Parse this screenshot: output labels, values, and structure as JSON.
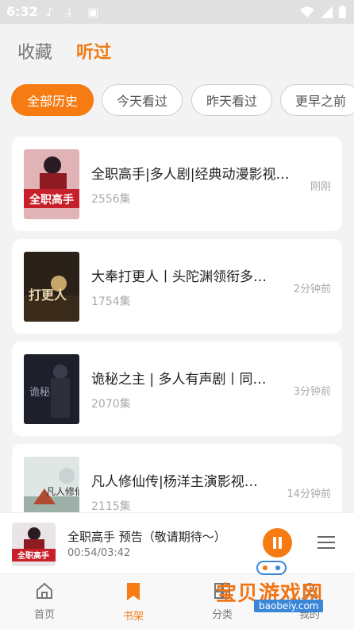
{
  "status_bar": {
    "time": "6:32"
  },
  "header": {
    "tab_favorites": "收藏",
    "tab_listened": "听过"
  },
  "filters": [
    "全部历史",
    "今天看过",
    "昨天看过",
    "更早之前"
  ],
  "items": [
    {
      "title": "全职高手|多人剧|经典动漫影视…",
      "count": "2556集",
      "time": "刚刚",
      "cover_text": "全职高手",
      "cover_color": "#c8202a"
    },
    {
      "title": "大奉打更人丨头陀渊领衔多…",
      "count": "1754集",
      "time": "2分钟前",
      "cover_text": "打更人",
      "cover_color": "#2a2118"
    },
    {
      "title": "诡秘之主 | 多人有声剧丨同…",
      "count": "2070集",
      "time": "3分钟前",
      "cover_text": "诡秘",
      "cover_color": "#1d1f2b"
    },
    {
      "title": "凡人修仙传|杨洋主演影视…",
      "count": "2115集",
      "time": "14分钟前",
      "cover_text": "凡人修仙传",
      "cover_color": "#c9d3d3"
    }
  ],
  "player": {
    "title": "全职高手 预告（敬请期待～）",
    "time": "00:54/03:42",
    "cover_text": "全职高手"
  },
  "nav": {
    "home": "首页",
    "shelf": "书架",
    "category": "分类",
    "mine": "我的"
  },
  "watermark": {
    "text": "宝贝游戏网",
    "url": "baobeiy.com"
  },
  "colors": {
    "accent": "#f57b12"
  }
}
